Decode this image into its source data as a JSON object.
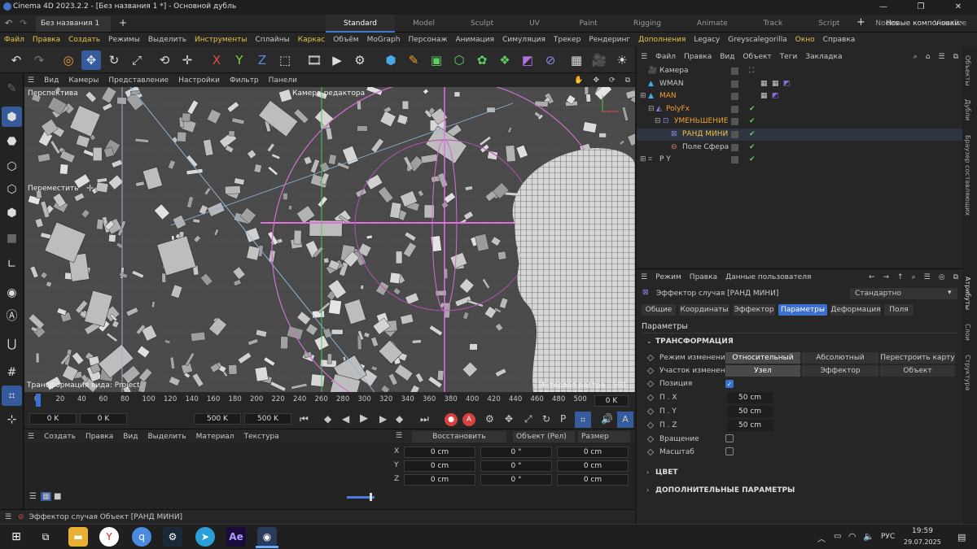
{
  "window": {
    "title": "Cinema 4D 2023.2.2 - [Без названия 1 *] - Основной дубль",
    "doc_tab": "Без названия 1 *"
  },
  "layouts": {
    "items": [
      "Standard",
      "Model",
      "Sculpt",
      "UV Edit",
      "Paint",
      "Rigging",
      "Animate",
      "Track",
      "Script",
      "Nodes",
      "Visualize"
    ],
    "new_layout": "Новые компоновки"
  },
  "menu": [
    "Файл",
    "Правка",
    "Создать",
    "Режимы",
    "Выделить",
    "Инструменты",
    "Сплайны",
    "Каркас",
    "Объём",
    "MoGraph",
    "Персонаж",
    "Анимация",
    "Симуляция",
    "Трекер",
    "Рендеринг",
    "Дополнения",
    "Legacy",
    "Greyscalegorilla",
    "Окно",
    "Справка"
  ],
  "viewport": {
    "menu": [
      "Вид",
      "Камеры",
      "Представление",
      "Настройки",
      "Фильтр",
      "Панели"
    ],
    "name": "Перспектива",
    "camera": "Камера-редактора",
    "tool": "Переместить",
    "hud_left": "Трансформация вида: Project",
    "hud_right": "Интервал растра : 500 cm"
  },
  "timeline": {
    "ticks": [
      "0",
      "20",
      "40",
      "60",
      "80",
      "100",
      "120",
      "140",
      "160",
      "180",
      "200",
      "220",
      "240",
      "260",
      "280",
      "300",
      "320",
      "340",
      "360",
      "380",
      "400",
      "420",
      "440",
      "460",
      "480",
      "500"
    ],
    "frame": "0 K"
  },
  "transport": {
    "f1": "0 K",
    "f2": "0 K",
    "f3": "500 K",
    "f4": "500 K"
  },
  "material": {
    "menu": [
      "Создать",
      "Правка",
      "Вид",
      "Выделить",
      "Материал",
      "Текстура"
    ]
  },
  "coords": {
    "restore": "Восстановить координаты",
    "mode": "Объект (Рел)",
    "size": "Размер",
    "rows": [
      {
        "axis": "X",
        "pos": "0 cm",
        "rot": "0 °",
        "size": "0 cm"
      },
      {
        "axis": "Y",
        "pos": "0 cm",
        "rot": "0 °",
        "size": "0 cm"
      },
      {
        "axis": "Z",
        "pos": "0 cm",
        "rot": "0 °",
        "size": "0 cm"
      }
    ]
  },
  "status": {
    "text": "Эффектор случая Объект [РАНД МИНИ]"
  },
  "objects": {
    "menu": [
      "Файл",
      "Правка",
      "Вид",
      "Объект",
      "Теги",
      "Закладка"
    ],
    "items": [
      {
        "name": "Камера"
      },
      {
        "name": "WMAN"
      },
      {
        "name": "MAN"
      },
      {
        "name": "PolyFx"
      },
      {
        "name": "УМЕНЬШЕНИЕ"
      },
      {
        "name": "РАНД МИНИ"
      },
      {
        "name": "Поле Сфера"
      },
      {
        "name": "P Y"
      }
    ]
  },
  "attributes": {
    "menu": [
      "Режим",
      "Правка",
      "Данные пользователя"
    ],
    "object": "Эффектор случая [РАНД МИНИ]",
    "preset": "Стандартно",
    "tabs": [
      "Общие",
      "Координаты",
      "Эффектор",
      "Параметры",
      "Деформация",
      "Поля"
    ],
    "section": "Параметры",
    "group": "ТРАНСФОРМАЦИЯ",
    "mode_label": "Режим изменения",
    "mode_opts": [
      "Относительный",
      "Абсолютный",
      "Перестроить карту"
    ],
    "area_label": "Участок изменения",
    "area_opts": [
      "Узел",
      "Эффектор",
      "Объект"
    ],
    "pos_label": "Позиция",
    "px": {
      "label": "П . X",
      "value": "50 cm"
    },
    "py": {
      "label": "П . Y",
      "value": "50 cm"
    },
    "pz": {
      "label": "П . Z",
      "value": "50 cm"
    },
    "rot_label": "Вращение",
    "scale_label": "Масштаб",
    "color_group": "ЦВЕТ",
    "extra_group": "ДОПОЛНИТЕЛЬНЫЕ ПАРАМЕТРЫ"
  },
  "side_tabs": [
    "Объекты",
    "Дубли",
    "Браузер составляющих",
    "Атрибуты",
    "Слои",
    "Структура"
  ],
  "taskbar": {
    "lang": "РУС",
    "time": "19:59",
    "date": "29.07.2025"
  }
}
